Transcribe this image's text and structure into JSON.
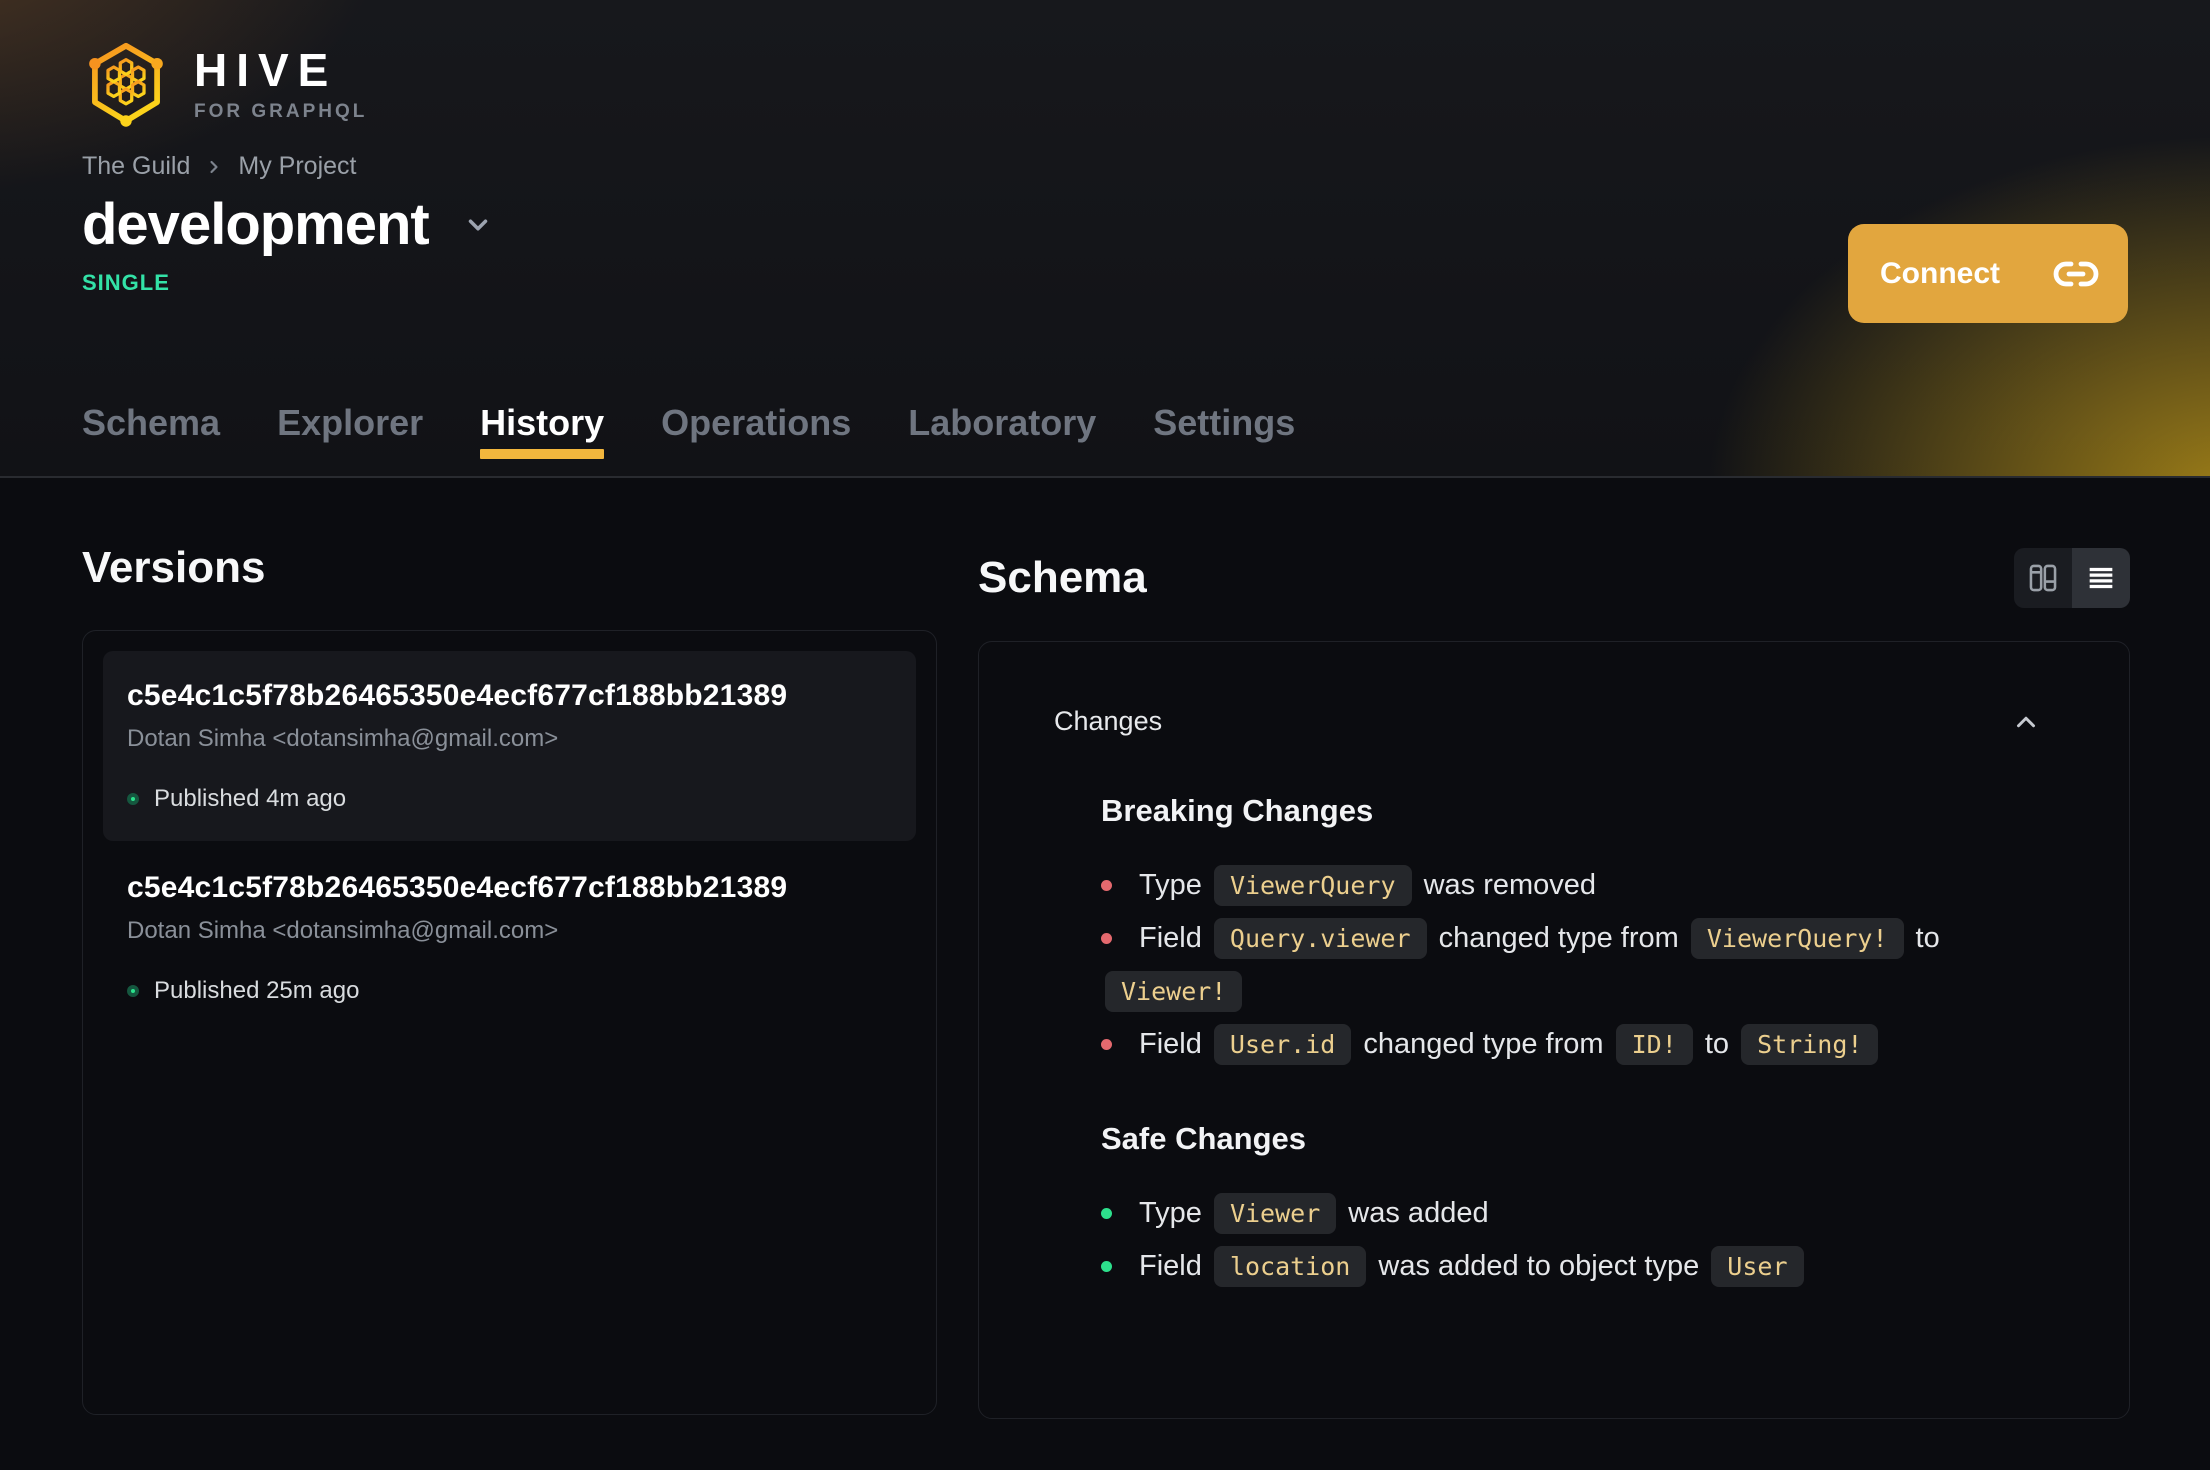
{
  "brand": {
    "name": "HIVE",
    "tagline": "FOR GRAPHQL"
  },
  "breadcrumb": {
    "items": [
      "The Guild",
      "My Project"
    ]
  },
  "target": {
    "name": "development",
    "badge": "SINGLE"
  },
  "connect": {
    "label": "Connect"
  },
  "tabs": [
    {
      "label": "Schema",
      "active": false
    },
    {
      "label": "Explorer",
      "active": false
    },
    {
      "label": "History",
      "active": true
    },
    {
      "label": "Operations",
      "active": false
    },
    {
      "label": "Laboratory",
      "active": false
    },
    {
      "label": "Settings",
      "active": false
    }
  ],
  "versions": {
    "title": "Versions",
    "items": [
      {
        "hash": "c5e4c1c5f78b26465350e4ecf677cf188bb21389",
        "author": "Dotan Simha <dotansimha@gmail.com>",
        "status": "Published 4m ago",
        "selected": true
      },
      {
        "hash": "c5e4c1c5f78b26465350e4ecf677cf188bb21389",
        "author": "Dotan Simha <dotansimha@gmail.com>",
        "status": "Published 25m ago",
        "selected": false
      }
    ]
  },
  "schema": {
    "title": "Schema",
    "changes": {
      "header": "Changes",
      "sections": [
        {
          "title": "Breaking Changes",
          "kind": "breaking",
          "items": [
            [
              {
                "text": "Type "
              },
              {
                "code": "ViewerQuery"
              },
              {
                "text": " was removed"
              }
            ],
            [
              {
                "text": "Field "
              },
              {
                "code": "Query.viewer"
              },
              {
                "text": " changed type from "
              },
              {
                "code": "ViewerQuery!"
              },
              {
                "text": " to "
              },
              {
                "code": "Viewer!"
              }
            ],
            [
              {
                "text": "Field "
              },
              {
                "code": "User.id"
              },
              {
                "text": " changed type from "
              },
              {
                "code": "ID!"
              },
              {
                "text": " to "
              },
              {
                "code": "String!"
              }
            ]
          ]
        },
        {
          "title": "Safe Changes",
          "kind": "safe",
          "items": [
            [
              {
                "text": "Type "
              },
              {
                "code": "Viewer"
              },
              {
                "text": " was added"
              }
            ],
            [
              {
                "text": "Field "
              },
              {
                "code": "location"
              },
              {
                "text": " was added to object type "
              },
              {
                "code": "User"
              }
            ]
          ]
        }
      ]
    }
  },
  "icons": [
    "hive-logo-icon",
    "chevron-right-icon",
    "chevron-down-icon",
    "chevron-up-icon",
    "link-icon",
    "columns-view-icon",
    "list-view-icon",
    "published-dot-icon"
  ],
  "colors": {
    "accent_button": "#e2a63e",
    "accent_underline": "#f2b63d",
    "badge_green": "#33e2a7",
    "published_green": "#2be28c",
    "breaking_red": "#e4696e",
    "safe_green": "#2de08c",
    "code_text": "#eccf8e"
  }
}
